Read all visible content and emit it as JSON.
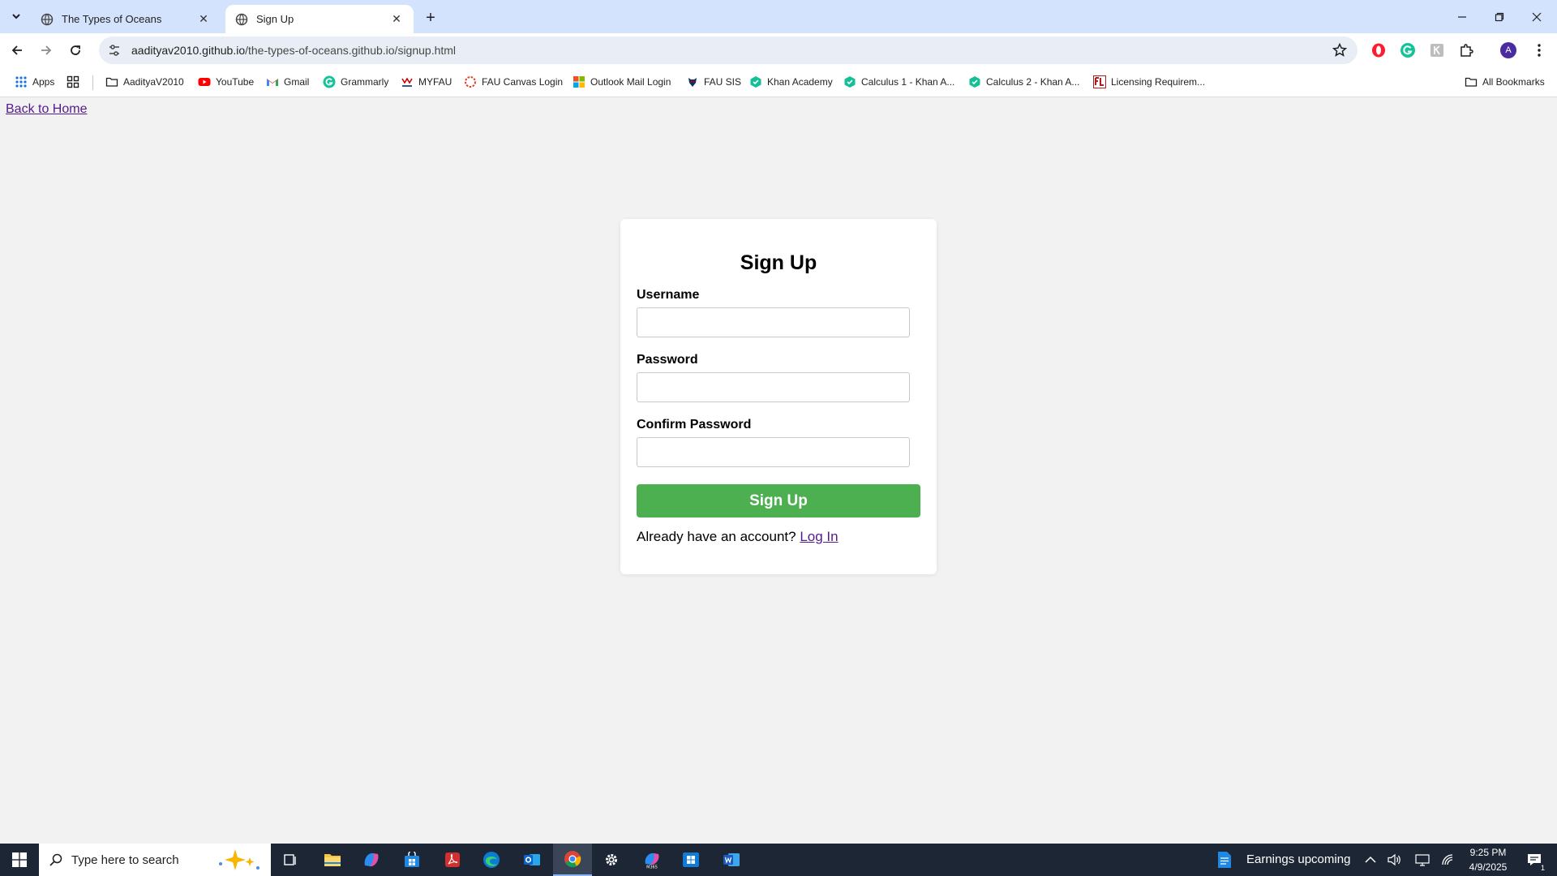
{
  "browser": {
    "tabs": [
      {
        "title": "The Types of Oceans",
        "active": false
      },
      {
        "title": "Sign Up",
        "active": true
      }
    ],
    "url_host": "aadityav2010.github.io",
    "url_path": "/the-types-of-oceans.github.io/signup.html",
    "profile_initial": "A"
  },
  "bookmarks": [
    {
      "label": "Apps",
      "icon": "apps-grid-icon"
    },
    {
      "label": "AadityaV2010",
      "icon": "folder-icon"
    },
    {
      "label": "YouTube",
      "icon": "youtube-icon"
    },
    {
      "label": "Gmail",
      "icon": "gmail-icon"
    },
    {
      "label": "Grammarly",
      "icon": "grammarly-icon"
    },
    {
      "label": "MYFAU",
      "icon": "myfau-icon"
    },
    {
      "label": "FAU Canvas Login",
      "icon": "canvas-icon"
    },
    {
      "label": "Outlook Mail Login",
      "icon": "microsoft-icon"
    },
    {
      "label": "FAU SIS",
      "icon": "fau-owl-icon"
    },
    {
      "label": "Khan Academy",
      "icon": "khan-academy-icon"
    },
    {
      "label": "Calculus 1 - Khan A...",
      "icon": "khan-academy-icon"
    },
    {
      "label": "Calculus 2 - Khan A...",
      "icon": "khan-academy-icon"
    },
    {
      "label": "Licensing Requirem...",
      "icon": "fl-icon"
    }
  ],
  "all_bookmarks": "All Bookmarks",
  "page": {
    "back_link": "Back to Home",
    "form": {
      "title": "Sign Up",
      "username_label": "Username",
      "password_label": "Password",
      "confirm_label": "Confirm Password",
      "submit_label": "Sign Up",
      "login_prompt": "Already have an account?",
      "login_link": "Log In"
    }
  },
  "taskbar": {
    "search_placeholder": "Type here to search",
    "news": "Earnings upcoming",
    "time": "9:25 PM",
    "date": "4/9/2025",
    "notification_count": "1"
  },
  "colors": {
    "tabstrip": "#d3e3fd",
    "submit": "#4caf50",
    "visited_link": "#551a8b",
    "taskbar": "#1c2634"
  }
}
